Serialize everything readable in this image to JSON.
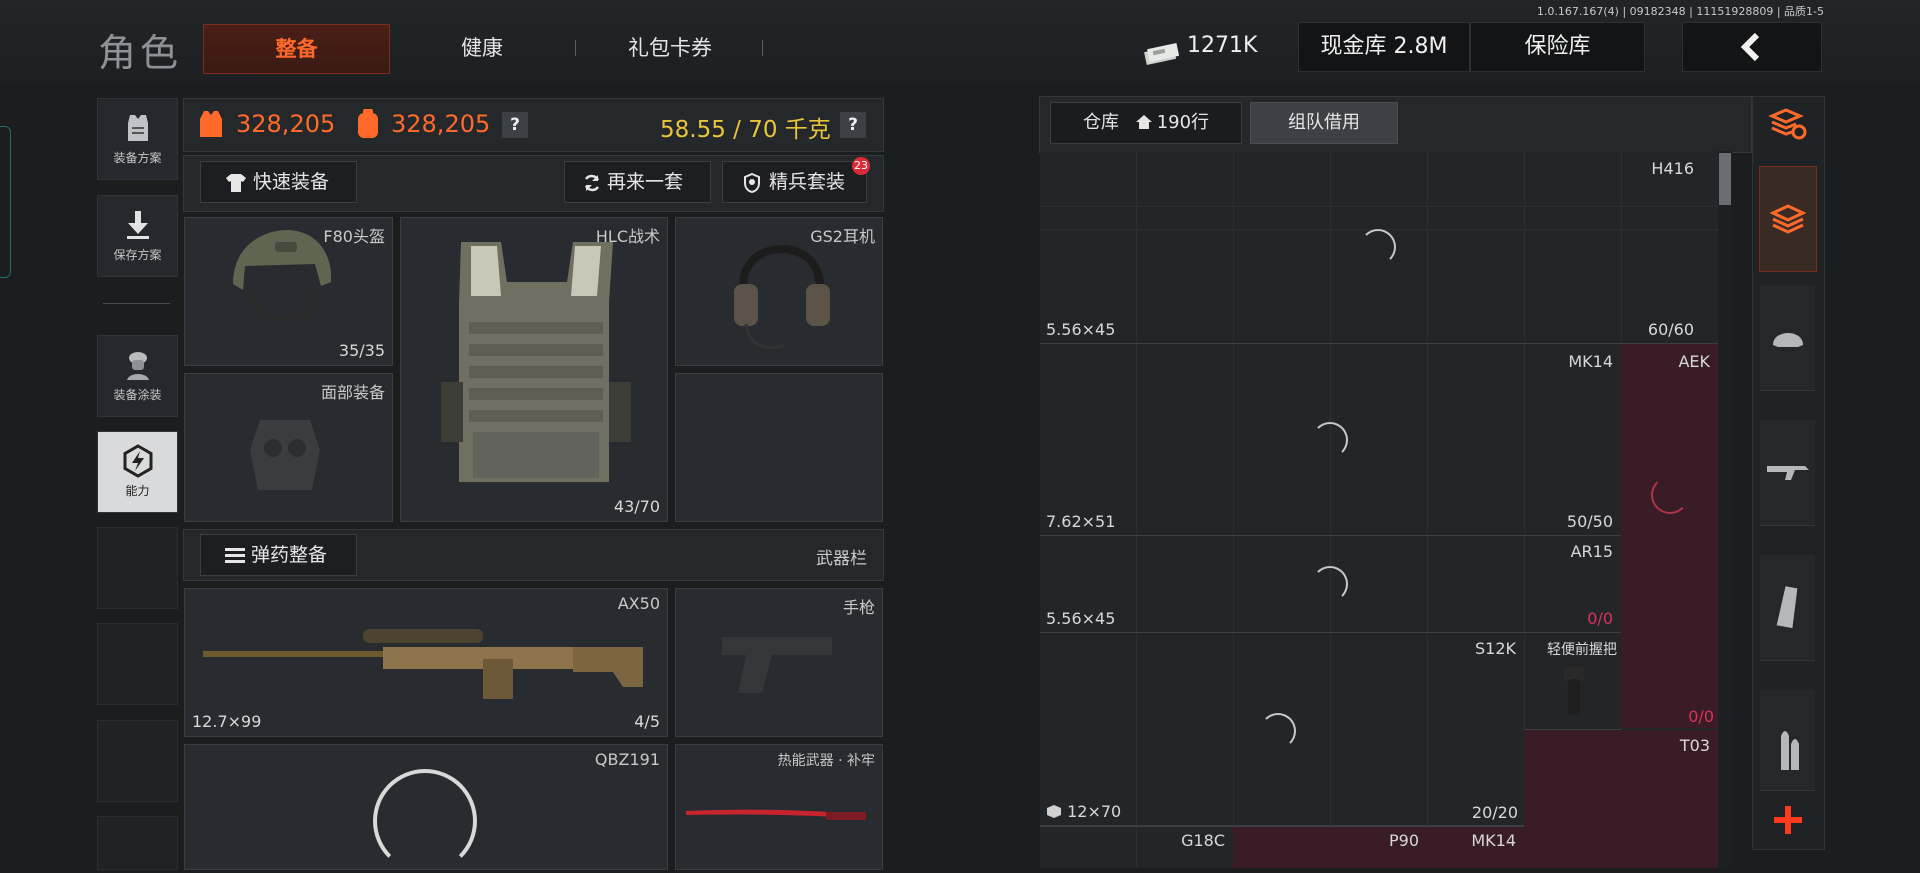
{
  "version": "1.0.167.167(4) | 09182348 | 11151928809 | 品质1-5",
  "header": {
    "title": "角色",
    "tabs": [
      "整备",
      "健康",
      "礼包卡券"
    ],
    "currency": "1271K",
    "cash_vault": "现金库 2.8M",
    "safe": "保险库"
  },
  "sidebar": {
    "items": [
      {
        "label": "装备方案",
        "icon": "vest-icon"
      },
      {
        "label": "保存方案",
        "icon": "download-icon"
      },
      {
        "label": "装备涂装",
        "icon": "soldier-icon"
      },
      {
        "label": "能力",
        "icon": "lightning-hex-icon"
      }
    ]
  },
  "stats": {
    "value1": "328,205",
    "value2": "328,205",
    "weight": "58.55 / 70 千克",
    "help": "?"
  },
  "actions": {
    "quick_equip": "快速装备",
    "again": "再来一套",
    "elite": "精兵套装",
    "elite_badge": "23"
  },
  "gear": {
    "helmet": {
      "name": "F80头盔",
      "count": "35/35"
    },
    "armor": {
      "name": "HLC战术",
      "count": "43/70"
    },
    "headset": {
      "name": "GS2耳机"
    },
    "face": {
      "name": "面部装备"
    }
  },
  "ammo": {
    "button": "弹药整备",
    "weapon_bar": "武器栏"
  },
  "weapons": {
    "primary": {
      "name": "AX50",
      "caliber": "12.7×99",
      "count": "4/5"
    },
    "pistol": {
      "name": "手枪"
    },
    "secondary": {
      "name": "QBZ191"
    },
    "melee": {
      "name": "热能武器 · 补牢"
    }
  },
  "storage": {
    "tab1": "仓库",
    "tab1_rows": "190行",
    "tab2": "组队借用",
    "items": [
      {
        "name": "H416",
        "caliber": "5.56×45",
        "count": "60/60"
      },
      {
        "name": "MK14",
        "caliber": "7.62×51",
        "count": "50/50"
      },
      {
        "name": "AEK"
      },
      {
        "name": "AR15",
        "caliber": "5.56×45",
        "count": "0/0"
      },
      {
        "name": "S12K"
      },
      {
        "name": "轻便前握把",
        "count": "0/0"
      },
      {
        "name": "T03",
        "caliber": "12×70",
        "count": "20/20"
      },
      {
        "name": "G18C"
      },
      {
        "name": "P90"
      },
      {
        "name": "MK14"
      }
    ]
  },
  "colors": {
    "accent": "#ff6a2b",
    "gold": "#e8c53a",
    "highlight_cell": "#3a1c26",
    "red_count": "#d8335a"
  }
}
